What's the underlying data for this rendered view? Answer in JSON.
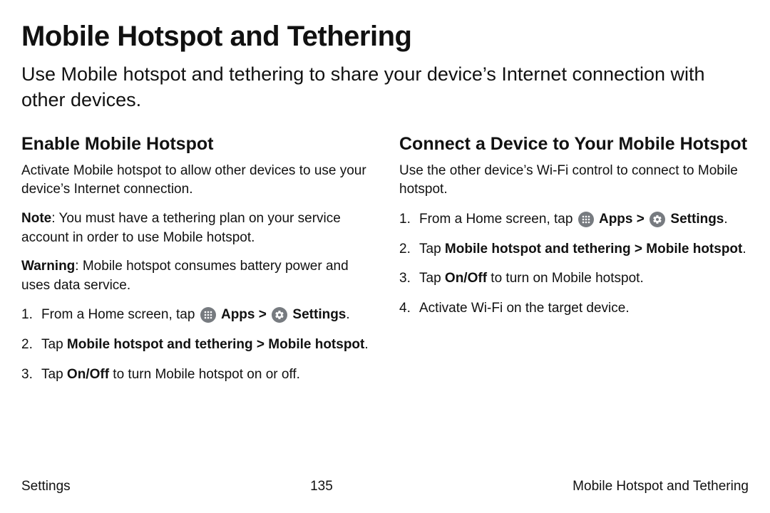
{
  "title": "Mobile Hotspot and Tethering",
  "intro": "Use Mobile hotspot and tethering to share your device’s Internet connection with other devices.",
  "left": {
    "heading": "Enable Mobile Hotspot",
    "p1": "Activate Mobile hotspot to allow other devices to use your device’s Internet connection.",
    "note_label": "Note",
    "note_text": ": You must have a tethering plan on your service account in order to use Mobile hotspot.",
    "warn_label": "Warning",
    "warn_text": ": Mobile hotspot consumes battery power and uses data service.",
    "step1_pre": "From a Home screen, tap ",
    "step1_apps": "Apps",
    "step1_sep": " > ",
    "step1_settings": "Settings",
    "step1_post": ".",
    "step2_pre": "Tap ",
    "step2_bold": "Mobile hotspot and tethering > Mobile hotspot",
    "step2_post": ".",
    "step3_pre": "Tap ",
    "step3_bold": "On/Off",
    "step3_post": " to turn Mobile hotspot on or off."
  },
  "right": {
    "heading": "Connect a Device to Your Mobile Hotspot",
    "p1": "Use the other device’s Wi-Fi control to connect to Mobile hotspot.",
    "step1_pre": "From a Home screen, tap ",
    "step1_apps": "Apps",
    "step1_sep": " > ",
    "step1_settings": "Settings",
    "step1_post": ".",
    "step2_pre": "Tap ",
    "step2_bold": "Mobile hotspot and tethering > Mobile hotspot",
    "step2_post": ".",
    "step3_pre": "Tap ",
    "step3_bold": "On/Off",
    "step3_post": " to turn on Mobile hotspot.",
    "step4": "Activate Wi-Fi on the target device."
  },
  "footer": {
    "left": "Settings",
    "center": "135",
    "right": "Mobile Hotspot and Tethering"
  }
}
